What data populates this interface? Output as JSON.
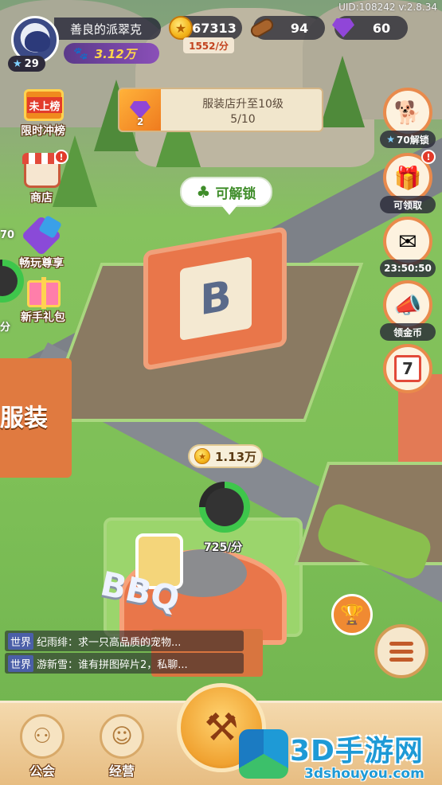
{
  "header": {
    "uid_version": "UID:108242 v:2.8.34",
    "player": {
      "name": "善良的派翠克",
      "level": "29",
      "fans": "3.12万"
    },
    "coins": "67313",
    "coin_rate": "1552/分",
    "wood": "94",
    "gems": "60"
  },
  "quest": {
    "title": "服装店升至10级",
    "progress": "5/10",
    "reward_count": "2"
  },
  "left_menu": [
    {
      "label": "限时冲榜",
      "badge": "未上榜"
    },
    {
      "label": "商店"
    },
    {
      "label": "畅玩尊享"
    },
    {
      "label": "新手礼包"
    }
  ],
  "right_menu": [
    {
      "label": "70解锁",
      "icon": "shiba-dog-icon"
    },
    {
      "label": "可领取",
      "icon": "gift-box-icon"
    },
    {
      "label": "23:50:50",
      "icon": "letter-icon"
    },
    {
      "label": "领金币",
      "icon": "megaphone-icon"
    },
    {
      "label": "",
      "icon": "calendar-icon",
      "calendar_day": "7"
    }
  ],
  "world": {
    "unlock_label": "可解锁",
    "bbq_income": "1.13万",
    "bbq_rate": "725/分",
    "bbq_progress": 0.75,
    "left_partial_top": "70",
    "left_partial_bottom": "分",
    "sign_bbq": "BBQ",
    "sign_clothes": "服装"
  },
  "chat": [
    {
      "channel": "世界",
      "text": "纪雨绯：求一只高品质的宠物..."
    },
    {
      "channel": "世界",
      "text": "游新雪：谁有拼图碎片2，私聊..."
    }
  ],
  "bottom_nav": [
    {
      "label": "公会",
      "icon": "guild-icon"
    },
    {
      "label": "经营",
      "icon": "manage-icon"
    }
  ],
  "watermark": {
    "title": "3D手游网",
    "url": "3dshouyou.com"
  },
  "colors": {
    "accent_orange": "#ef7b1f",
    "coin_gold": "#f4b41a",
    "gem_purple": "#9046d8",
    "progress_green": "#3ec64b"
  }
}
